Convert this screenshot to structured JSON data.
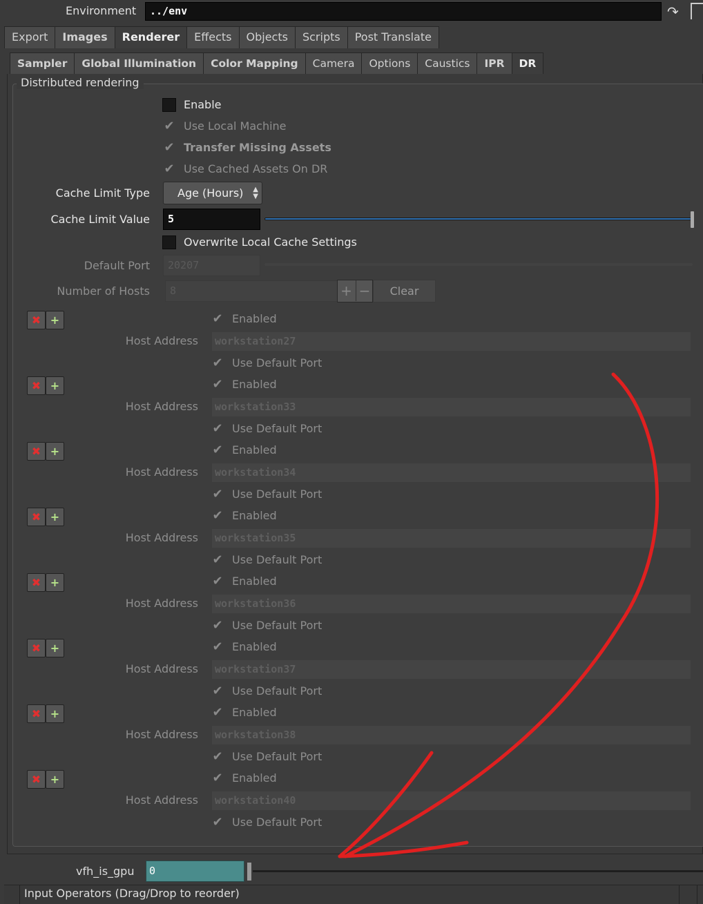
{
  "environment": {
    "label": "Environment",
    "value": "../env"
  },
  "tabs_primary": [
    {
      "label": "Export",
      "bold": false,
      "active": false
    },
    {
      "label": "Images",
      "bold": true,
      "active": false
    },
    {
      "label": "Renderer",
      "bold": true,
      "active": true
    },
    {
      "label": "Effects",
      "bold": false,
      "active": false
    },
    {
      "label": "Objects",
      "bold": false,
      "active": false
    },
    {
      "label": "Scripts",
      "bold": false,
      "active": false
    },
    {
      "label": "Post Translate",
      "bold": false,
      "active": false
    }
  ],
  "tabs_secondary": [
    {
      "label": "Sampler",
      "bold": true,
      "active": false
    },
    {
      "label": "Global Illumination",
      "bold": true,
      "active": false
    },
    {
      "label": "Color Mapping",
      "bold": true,
      "active": false
    },
    {
      "label": "Camera",
      "bold": false,
      "active": false
    },
    {
      "label": "Options",
      "bold": false,
      "active": false
    },
    {
      "label": "Caustics",
      "bold": false,
      "active": false
    },
    {
      "label": "IPR",
      "bold": true,
      "active": false
    },
    {
      "label": "DR",
      "bold": true,
      "active": true
    }
  ],
  "dr": {
    "group_title": "Distributed rendering",
    "enable": {
      "label": "Enable",
      "checked": false
    },
    "use_local_machine": {
      "label": "Use Local Machine",
      "checked": true
    },
    "transfer_missing_assets": {
      "label": "Transfer Missing Assets",
      "checked": true
    },
    "use_cached_assets": {
      "label": "Use Cached Assets On DR",
      "checked": true
    },
    "cache_limit_type": {
      "label": "Cache Limit Type",
      "value": "Age (Hours)"
    },
    "cache_limit_value": {
      "label": "Cache Limit Value",
      "value": "5"
    },
    "overwrite_local_cache": {
      "label": "Overwrite Local Cache Settings",
      "checked": false
    },
    "default_port": {
      "label": "Default Port",
      "value": "20207"
    },
    "number_of_hosts": {
      "label": "Number of Hosts",
      "value": "8",
      "clear_label": "Clear"
    },
    "host_enabled_label": "Enabled",
    "host_address_label": "Host Address",
    "host_default_port_label": "Use Default Port",
    "hosts": [
      {
        "address": "workstation27"
      },
      {
        "address": "workstation33"
      },
      {
        "address": "workstation34"
      },
      {
        "address": "workstation35"
      },
      {
        "address": "workstation36"
      },
      {
        "address": "workstation37"
      },
      {
        "address": "workstation38"
      },
      {
        "address": "workstation40"
      }
    ]
  },
  "gpu": {
    "label": "vfh_is_gpu",
    "value": "0"
  },
  "status": {
    "text": "Input Operators (Drag/Drop to reorder)"
  },
  "icons": {
    "delete": "close-icon",
    "add": "plus-icon",
    "check": "check-icon"
  },
  "colors": {
    "accent_slider": "#2d6fb0",
    "annotation": "#e02020",
    "gpu_field": "#4a8c8c"
  }
}
